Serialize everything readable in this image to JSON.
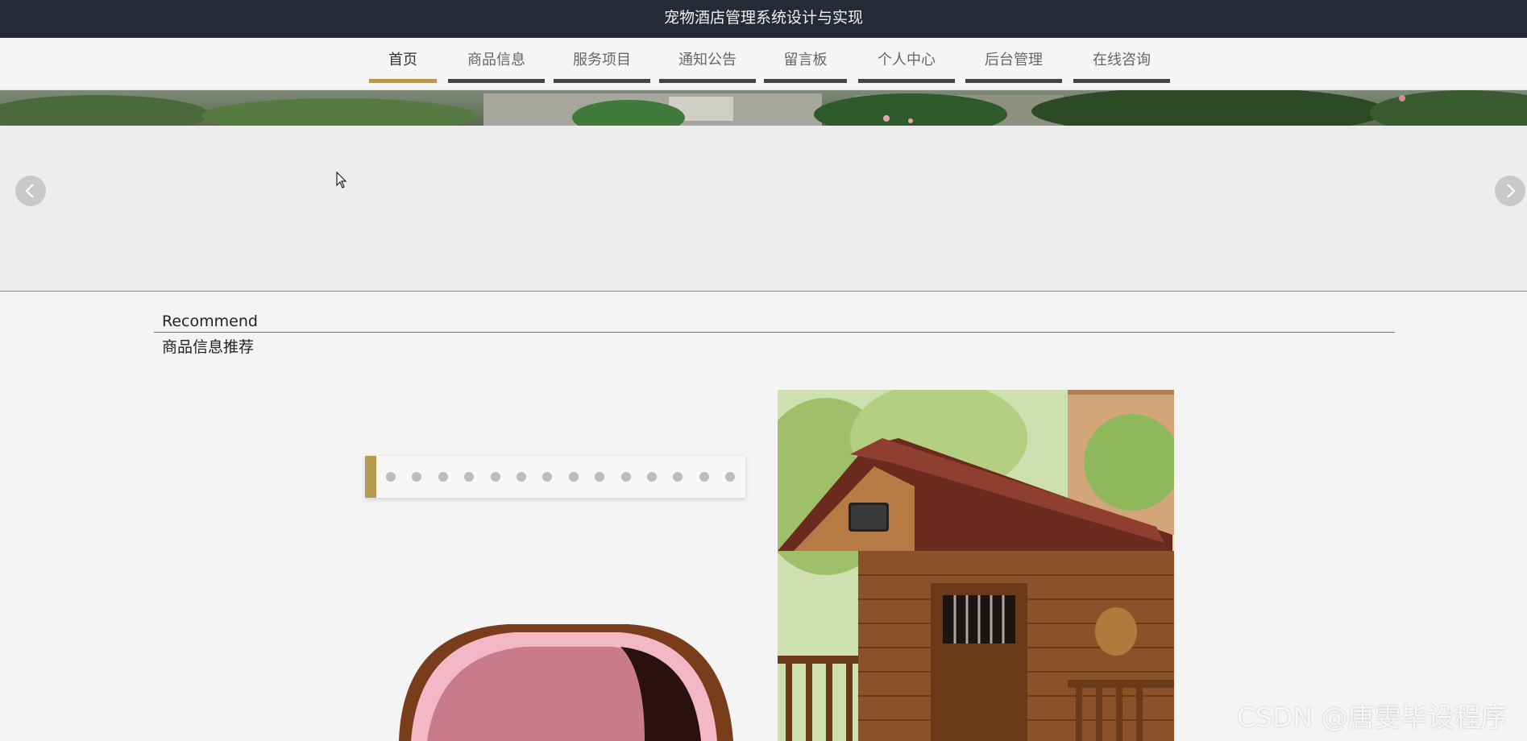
{
  "header": {
    "title": "宠物酒店管理系统设计与实现"
  },
  "nav": {
    "items": [
      {
        "label": "首页",
        "active": true
      },
      {
        "label": "商品信息",
        "active": false
      },
      {
        "label": "服务项目",
        "active": false
      },
      {
        "label": "通知公告",
        "active": false
      },
      {
        "label": "留言板",
        "active": false
      },
      {
        "label": "个人中心",
        "active": false
      },
      {
        "label": "后台管理",
        "active": false
      },
      {
        "label": "在线咨询",
        "active": false
      }
    ]
  },
  "banner": {
    "prev_icon": "chevron-left-icon",
    "next_icon": "chevron-right-icon"
  },
  "recommend": {
    "title_en": "Recommend",
    "title_cn": "商品信息推荐"
  },
  "carousel": {
    "dot_count": 14
  },
  "colors": {
    "topbar": "#252a36",
    "accent": "#b59a50",
    "nav_underline": "#444444"
  },
  "watermark": "CSDN @唐雯毕设程序"
}
